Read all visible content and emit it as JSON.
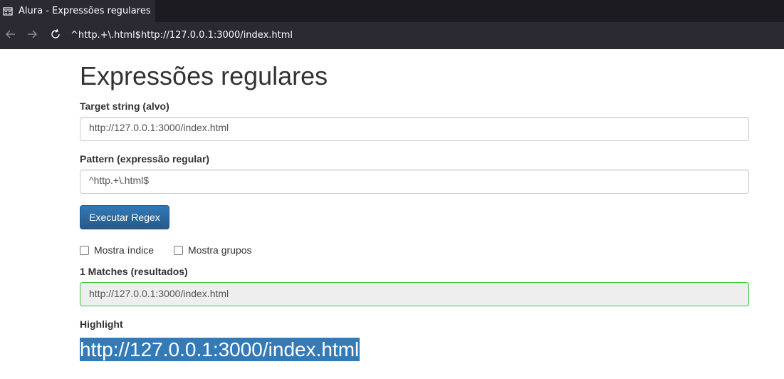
{
  "browser": {
    "tab_title": "Alura - Expressões regulares",
    "url": "^http.+\\.html$http://127.0.0.1:3000/index.html"
  },
  "page": {
    "title": "Expressões regulares",
    "target": {
      "label": "Target string (alvo)",
      "value": "http://127.0.0.1:3000/index.html"
    },
    "pattern": {
      "label": "Pattern (expressão regular)",
      "value": "^http.+\\.html$"
    },
    "execute_button": "Executar Regex",
    "options": [
      {
        "label": "Mostra índice",
        "checked": false
      },
      {
        "label": "Mostra grupos",
        "checked": false
      }
    ],
    "matches": {
      "label": "1 Matches (resultados)",
      "value": "http://127.0.0.1:3000/index.html",
      "border_color": "#33cc33"
    },
    "highlight": {
      "label": "Highlight",
      "value": "http://127.0.0.1:3000/index.html",
      "color": "#337ab7"
    }
  }
}
